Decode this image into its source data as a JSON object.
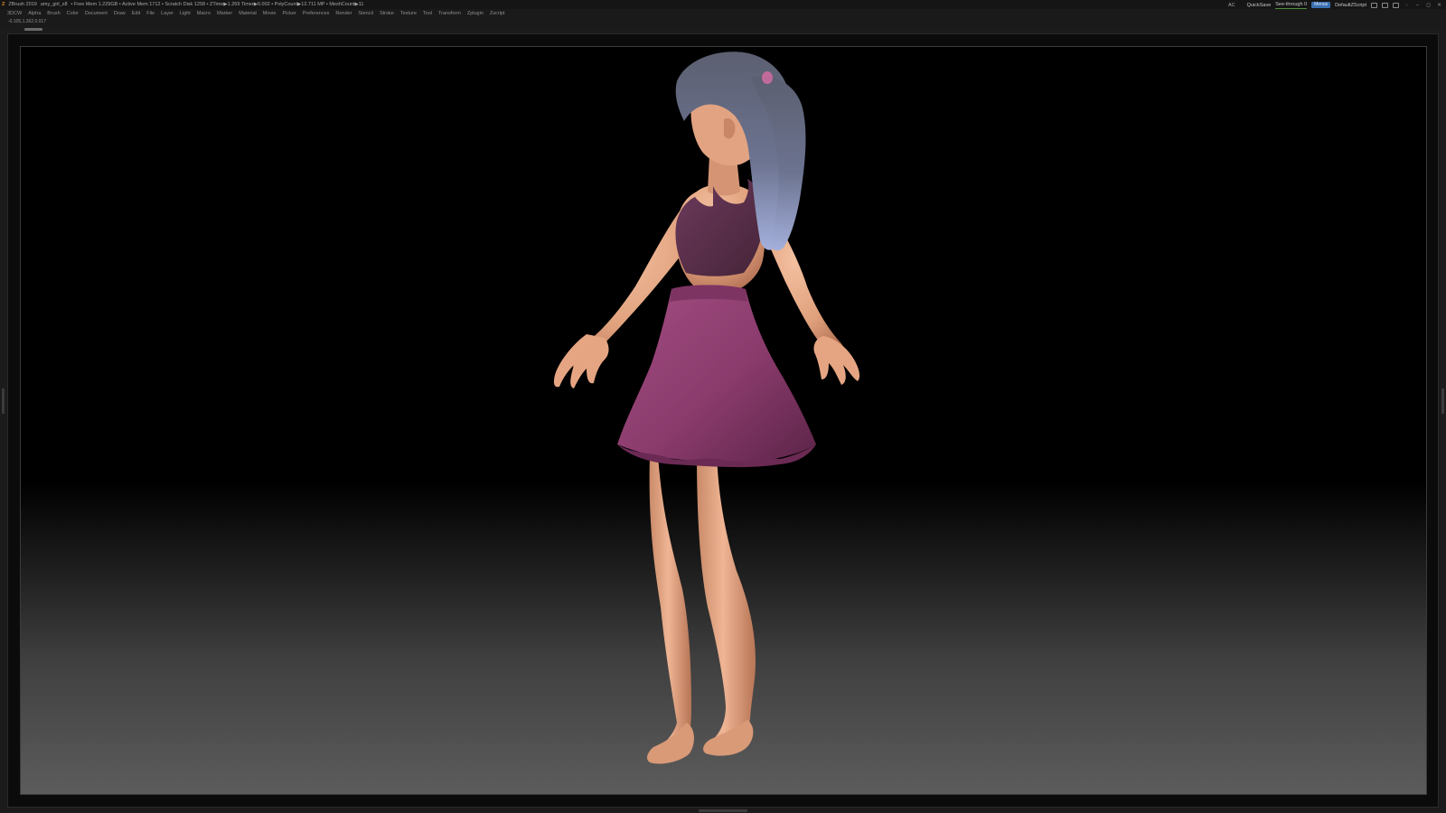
{
  "titlebar": {
    "app_name": "ZBrush 2019",
    "file_name": "amy_girl_x8",
    "stats": "• Free Mem 1.229GB • Active Mem 1712 • Scratch Disk 1258 • ZTime▶1.269 Timer▶0.002 • PolyCount▶12.711 MP • MeshCount▶11",
    "ac_label": "AC",
    "quicksave_label": "QuickSave",
    "see_through_label": "See-through 0",
    "menus_label": "Menus",
    "script_label": "DefaultZScript"
  },
  "menubar": {
    "items": [
      "3DCW",
      "Alpha",
      "Brush",
      "Color",
      "Document",
      "Draw",
      "Edit",
      "File",
      "Layer",
      "Light",
      "Macro",
      "Marker",
      "Material",
      "Movie",
      "Picker",
      "Preferences",
      "Render",
      "Stencil",
      "Stroke",
      "Texture",
      "Tool",
      "Transform",
      "Zplugin",
      "Zscript"
    ]
  },
  "coordinates": "-0.105,1.262,0.017",
  "colors": {
    "skin": "#e8a884",
    "skin_shadow": "#b9765a",
    "skirt": "#8c3d6e",
    "skirt_shadow": "#5e2449",
    "top": "#5a2e4a",
    "hair": "#555a6e",
    "hair_tip": "#9aa6d2",
    "tie": "#c06a9a"
  }
}
